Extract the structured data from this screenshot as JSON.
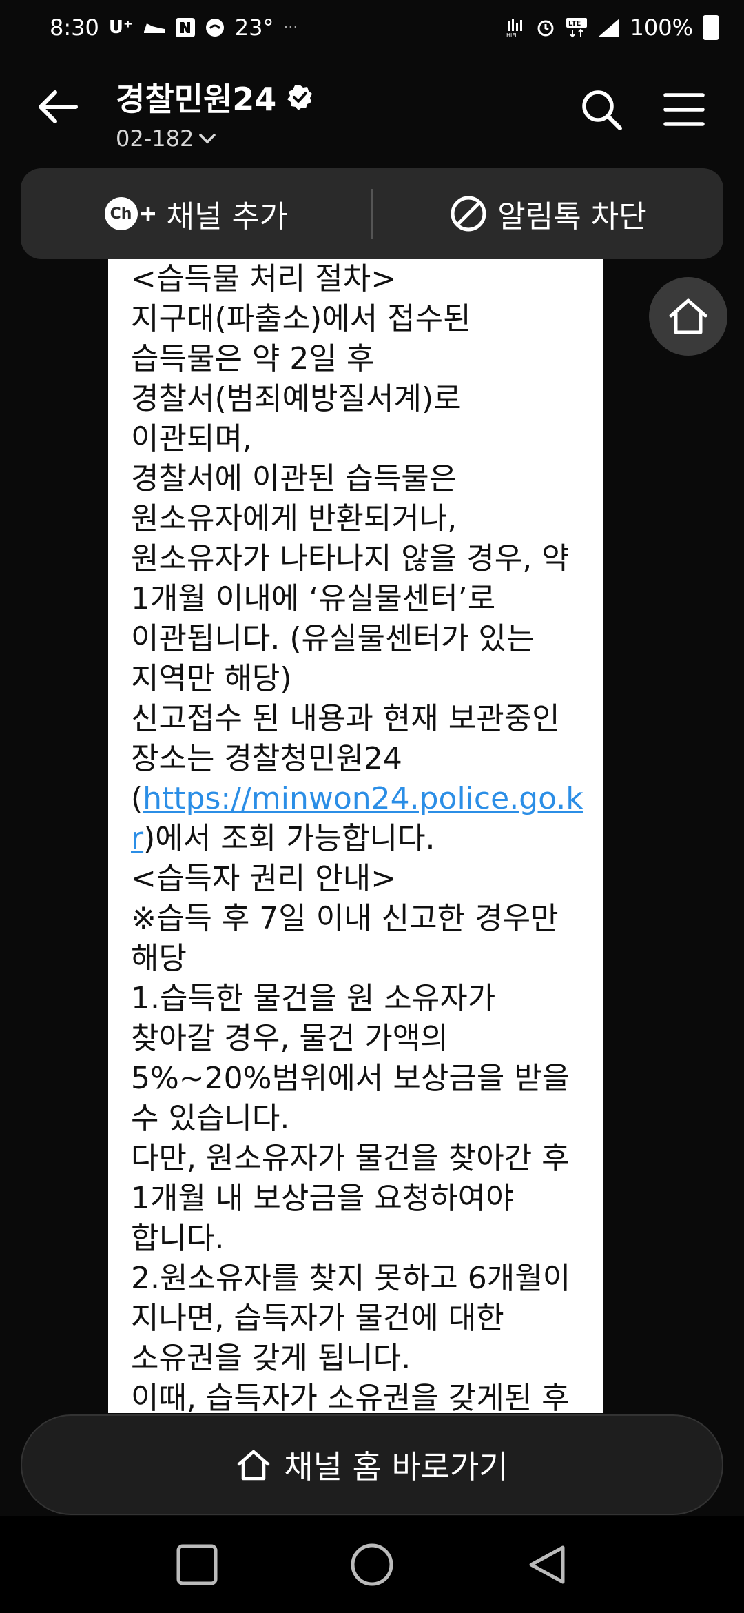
{
  "status_bar": {
    "time": "8:30",
    "carrier": "U⁺",
    "temperature": "23°",
    "overflow": "···",
    "battery": "100%",
    "icons": [
      "hifi-icon",
      "alarm-icon",
      "lte-icon",
      "signal-icon",
      "battery-icon"
    ]
  },
  "header": {
    "title": "경찰민원24",
    "subtitle": "02-182"
  },
  "channel_bar": {
    "add_label": "채널 추가",
    "ch_badge": "Ch",
    "block_label": "알림톡 차단"
  },
  "message": {
    "part1": "<습득물 처리 절차>\n지구대(파출소)에서 접수된\n습득물은 약 2일 후\n경찰서(범죄예방질서계)로\n이관되며,\n경찰서에 이관된 습득물은\n원소유자에게 반환되거나,\n원소유자가 나타나지 않을 경우, 약\n1개월 이내에 ‘유실물센터’로\n이관됩니다. (유실물센터가 있는\n지역만 해당)\n신고접수 된 내용과 현재 보관중인\n장소는 경찰청민원24\n(",
    "link": "https://minwon24.police.go.kr",
    "part2": ")에서 조회 가능합니다.\n<습득자 권리 안내>\n※습득 후 7일 이내 신고한 경우만\n해당\n1.습득한 물건을 원 소유자가\n찾아갈 경우, 물건 가액의\n5%~20%범위에서 보상금을 받을\n수 있습니다.\n다만, 원소유자가 물건을 찾아간 후\n1개월 내 보상금을 요청하여야\n합니다.\n2.원소유자를 찾지 못하고 6개월이\n지나면, 습득자가 물건에 대한\n소유권을 갖게 됩니다.\n이때, 습득자가 소유권을 갖게된 후"
  },
  "bottom_button": {
    "label": "채널 홈 바로가기"
  },
  "colors": {
    "background": "#0a0a0a",
    "bar": "#2a2a2a",
    "link": "#2b8ee6"
  }
}
